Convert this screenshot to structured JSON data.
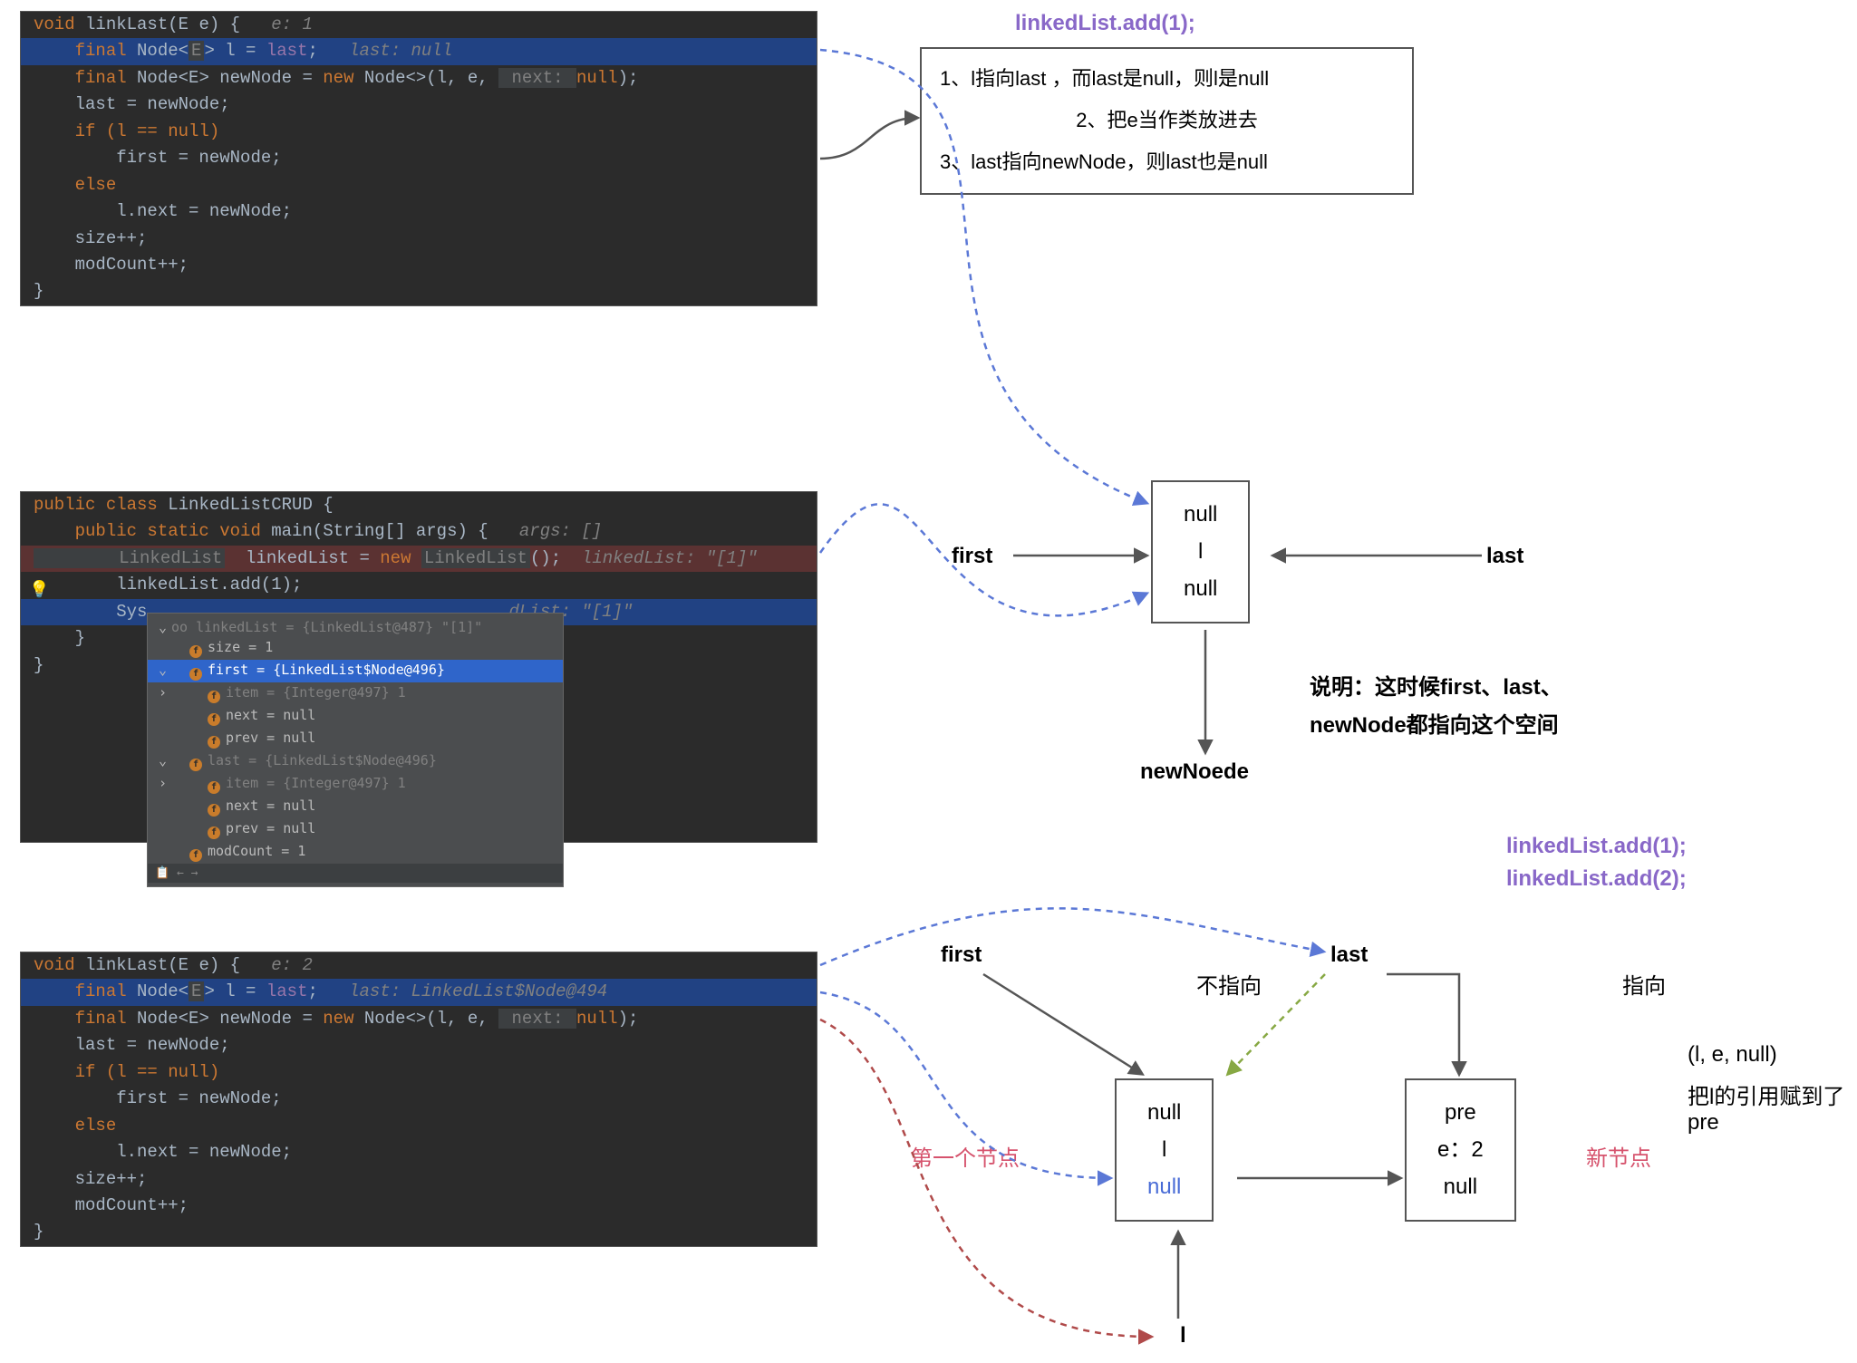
{
  "headers": {
    "h1": "linkedList.add(1);",
    "h2a": "linkedList.add(1);",
    "h2b": "linkedList.add(2);"
  },
  "annoBox": {
    "l1": "1、l指向last ，而last是null，则l是null",
    "l2": "2、把e当作类放进去",
    "l3": "3、last指向newNode，则last也是null"
  },
  "code1": {
    "l0": [
      "void ",
      "linkLast",
      "(E e) {   ",
      "e: 1"
    ],
    "l1": [
      "    final ",
      "Node",
      "<",
      "E",
      "> l = ",
      "last",
      ";   ",
      "last: null"
    ],
    "l2": [
      "    final ",
      "Node",
      "<E> newNode = ",
      "new ",
      "Node",
      "<>(l, e, ",
      " next: ",
      "null",
      ");"
    ],
    "l3": "    last = newNode;",
    "l4": "    if (l == null)",
    "l5": "        first = newNode;",
    "l6": "    else",
    "l7": "        l.next = newNode;",
    "l8": "    size++;",
    "l9": "    modCount++;",
    "l10": "}"
  },
  "code2": {
    "l0": [
      "public class ",
      "LinkedListCRUD",
      " {"
    ],
    "l1": [
      "    public static void ",
      "main",
      "(String[] args) {   ",
      "args: []"
    ],
    "l2": [
      "        LinkedList",
      "  linkedList = ",
      "new ",
      "LinkedList",
      "();  ",
      "linkedList: \"[1]\""
    ],
    "l3": "        linkedList.add(1);",
    "l4": [
      "        Sys",
      "                                   ",
      "dList: \"[1]\""
    ],
    "l5": "    }",
    "l6": "}"
  },
  "code3": {
    "l0": [
      "void ",
      "linkLast",
      "(E e) {   ",
      "e: 2"
    ],
    "l1": [
      "    final ",
      "Node",
      "<",
      "E",
      "> l = ",
      "last",
      ";   ",
      "last: LinkedList$Node@494"
    ],
    "l2": [
      "    final ",
      "Node",
      "<E> newNode = ",
      "new ",
      "Node",
      "<>(l, e, ",
      " next: ",
      "null",
      ");"
    ],
    "l3": "    last = newNode;",
    "l4": "    if (l == null)",
    "l5": "        first = newNode;",
    "l6": "    else",
    "l7": "        l.next = newNode;",
    "l8": "    size++;",
    "l9": "    modCount++;",
    "l10": "}"
  },
  "dbg": {
    "root": "oo linkedList = {LinkedList@487} \"[1]\"",
    "size": "size = 1",
    "first": "first = {LinkedList$Node@496}",
    "item1": "item = {Integer@497} 1",
    "next1": "next = null",
    "prev1": "prev = null",
    "last": "last = {LinkedList$Node@496}",
    "item2": "item = {Integer@497} 1",
    "next2": "next = null",
    "prev2": "prev = null",
    "mod": "modCount = 1"
  },
  "mid": {
    "first": "first",
    "last": "last",
    "newNode": "newNoede",
    "n1": "null",
    "n2": "l",
    "n3": "null",
    "expl1": "说明：这时候first、last、",
    "expl2": "newNode都指向这个空间"
  },
  "bot": {
    "first": "first",
    "last": "last",
    "not": "不指向",
    "yes": "指向",
    "firstNodeLabel": "第一个节点",
    "newNodeLabel": "新节点",
    "l": "l",
    "paren": "(l, e, null)",
    "paren2": "把l的引用赋到了pre",
    "b1a": "null",
    "b1b": "l",
    "b1c": "null",
    "b2a": "pre",
    "b2b": "e：2",
    "b2c": "null"
  }
}
